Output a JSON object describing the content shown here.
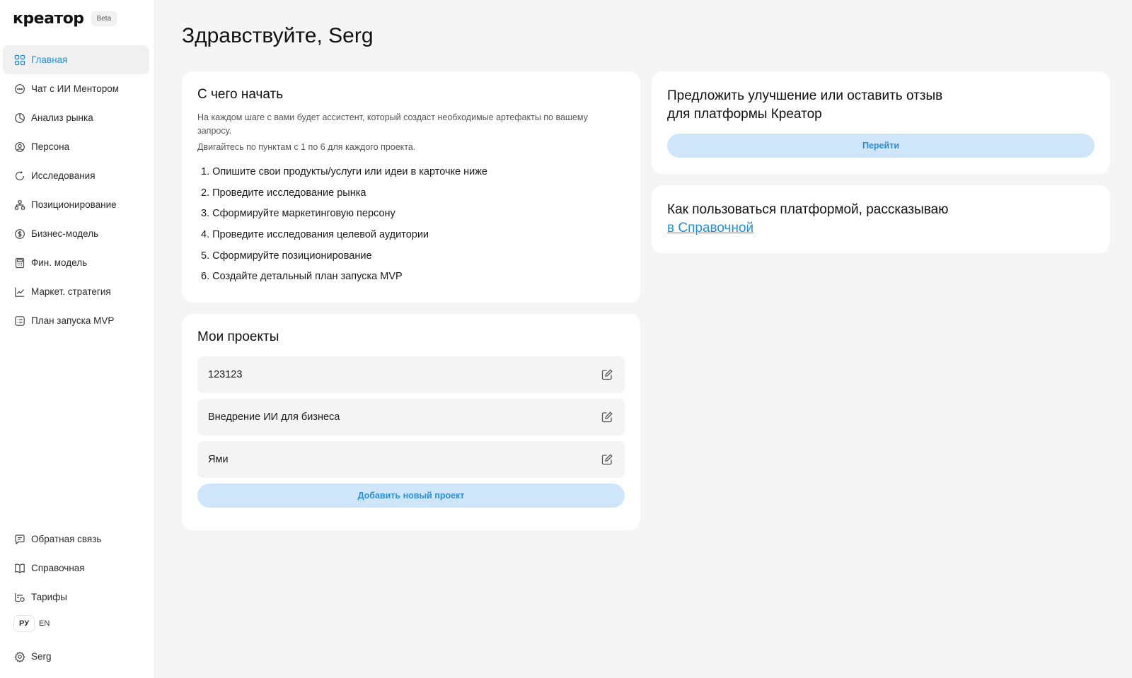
{
  "app": {
    "logo": "креатор",
    "badge": "Beta"
  },
  "sidebar": {
    "items": [
      {
        "label": "Главная",
        "icon": "grid-icon",
        "active": true
      },
      {
        "label": "Чат с ИИ Ментором",
        "icon": "chat-icon"
      },
      {
        "label": "Анализ рынка",
        "icon": "pie-chart-icon"
      },
      {
        "label": "Персона",
        "icon": "person-icon"
      },
      {
        "label": "Исследования",
        "icon": "refresh-icon"
      },
      {
        "label": "Позиционирование",
        "icon": "hierarchy-icon"
      },
      {
        "label": "Бизнес-модель",
        "icon": "dollar-icon"
      },
      {
        "label": "Фин. модель",
        "icon": "calculator-icon"
      },
      {
        "label": "Маркет. стратегия",
        "icon": "trend-icon"
      },
      {
        "label": "План запуска MVP",
        "icon": "checklist-icon"
      }
    ],
    "bottom": [
      {
        "label": "Обратная связь",
        "icon": "message-icon"
      },
      {
        "label": "Справочная",
        "icon": "book-icon"
      },
      {
        "label": "Тарифы",
        "icon": "tariff-icon"
      }
    ],
    "lang": {
      "ru": "РУ",
      "en": "EN",
      "selected": "РУ"
    },
    "user": {
      "label": "Serg",
      "icon": "gear-icon"
    }
  },
  "main": {
    "greeting": "Здравствуйте, Serg",
    "start": {
      "title": "С чего начать",
      "description": "На каждом шаге с вами будет ассистент, который создаст необходимые артефакты по вашему запросу.",
      "hint": "Двигайтесь по пунктам с 1 по 6 для каждого проекта.",
      "steps": [
        "1. Опишите свои продукты/услуги или идеи в карточке ниже",
        "2. Проведите исследование рынка",
        "3. Сформируйте маркетинговую персону",
        "4. Проведите исследования целевой аудитории",
        "5. Сформируйте позиционирование",
        "6. Создайте детальный план запуска MVP"
      ]
    },
    "projects": {
      "title": "Мои проекты",
      "items": [
        "123123",
        "Внедрение ИИ для бизнеса",
        "Ями"
      ],
      "add_label": "Добавить новый проект"
    },
    "feedback": {
      "title_line1": "Предложить улучшение или оставить отзыв",
      "title_line2": "для платформы Креатор",
      "button": "Перейти"
    },
    "help": {
      "text": "Как пользоваться платформой, рассказываю",
      "link": "в Справочной"
    }
  },
  "colors": {
    "accent": "#2590d8",
    "button_bg": "#cfe6fa",
    "page_bg": "#f5f5f5"
  }
}
